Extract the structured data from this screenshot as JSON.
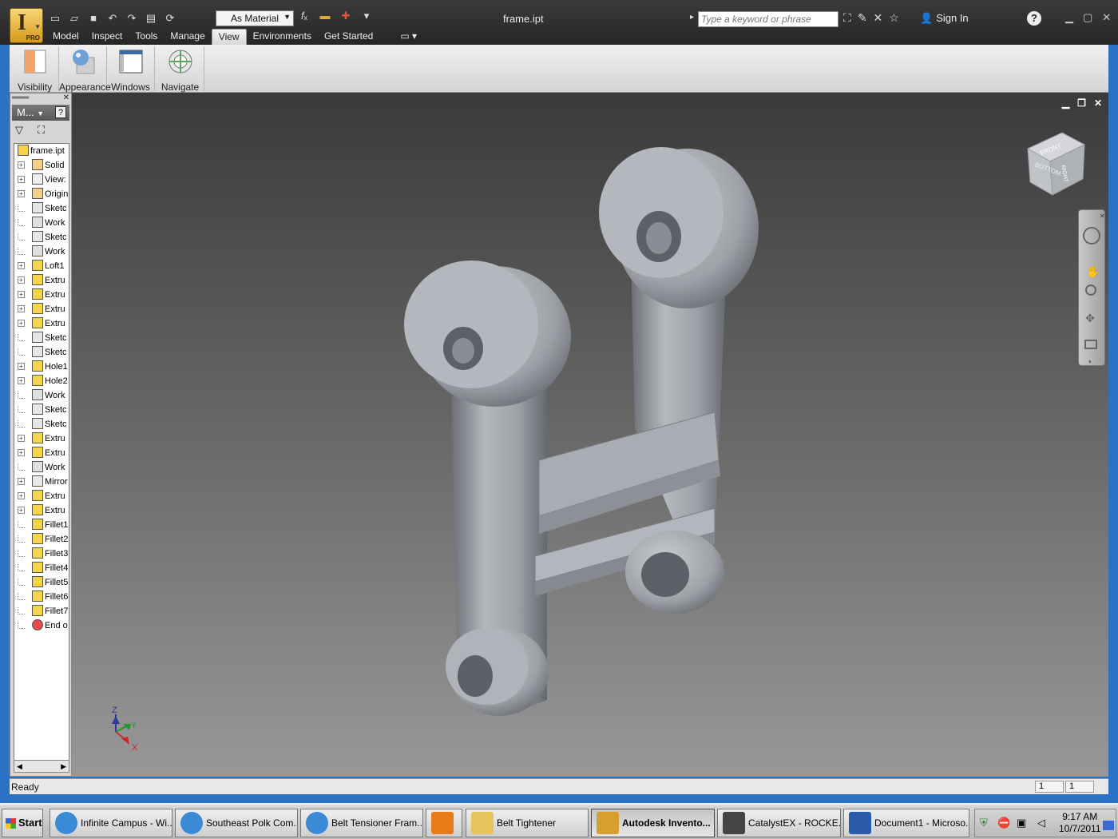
{
  "window": {
    "title": "frame.ipt"
  },
  "app": {
    "badge": "PRO"
  },
  "toolbar": {
    "material": "As Material"
  },
  "search": {
    "placeholder": "Type a keyword or phrase"
  },
  "account": {
    "sign_in": "Sign In",
    "help": "?"
  },
  "menu": [
    "Model",
    "Inspect",
    "Tools",
    "Manage",
    "View",
    "Environments",
    "Get Started"
  ],
  "ribbon": [
    "Visibility",
    "Appearance",
    "Windows",
    "Navigate"
  ],
  "browser": {
    "header": "M...",
    "help": "?",
    "root": "frame.ipt",
    "nodes": [
      {
        "label": "Solid",
        "icon": "folder-solid-icon",
        "expand": true
      },
      {
        "label": "View:",
        "icon": "view-rep-icon",
        "expand": true
      },
      {
        "label": "Origin",
        "icon": "folder-icon",
        "expand": true
      },
      {
        "label": "Sketc",
        "icon": "sketch-icon",
        "expand": false
      },
      {
        "label": "Work",
        "icon": "work-plane-icon",
        "expand": false
      },
      {
        "label": "Sketc",
        "icon": "sketch-icon",
        "expand": false
      },
      {
        "label": "Work",
        "icon": "work-plane-icon",
        "expand": false
      },
      {
        "label": "Loft1",
        "icon": "loft-icon",
        "expand": true
      },
      {
        "label": "Extru",
        "icon": "extrude-icon",
        "expand": true
      },
      {
        "label": "Extru",
        "icon": "extrude-icon",
        "expand": true
      },
      {
        "label": "Extru",
        "icon": "extrude-icon",
        "expand": true
      },
      {
        "label": "Extru",
        "icon": "extrude-icon",
        "expand": true
      },
      {
        "label": "Sketc",
        "icon": "sketch-icon",
        "expand": false
      },
      {
        "label": "Sketc",
        "icon": "sketch-icon",
        "expand": false
      },
      {
        "label": "Hole1",
        "icon": "hole-icon",
        "expand": true
      },
      {
        "label": "Hole2",
        "icon": "hole-icon",
        "expand": true
      },
      {
        "label": "Work",
        "icon": "work-plane-icon",
        "expand": false
      },
      {
        "label": "Sketc",
        "icon": "sketch-icon",
        "expand": false
      },
      {
        "label": "Sketc",
        "icon": "sketch-icon",
        "expand": false
      },
      {
        "label": "Extru",
        "icon": "extrude-icon",
        "expand": true
      },
      {
        "label": "Extru",
        "icon": "extrude-icon",
        "expand": true
      },
      {
        "label": "Work",
        "icon": "work-plane-icon",
        "expand": false
      },
      {
        "label": "Mirror",
        "icon": "mirror-icon",
        "expand": true
      },
      {
        "label": "Extru",
        "icon": "extrude-icon",
        "expand": true
      },
      {
        "label": "Extru",
        "icon": "extrude-icon",
        "expand": true
      },
      {
        "label": "Fillet1",
        "icon": "fillet-icon",
        "expand": false
      },
      {
        "label": "Fillet2",
        "icon": "fillet-icon",
        "expand": false
      },
      {
        "label": "Fillet3",
        "icon": "fillet-icon",
        "expand": false
      },
      {
        "label": "Fillet4",
        "icon": "fillet-icon",
        "expand": false
      },
      {
        "label": "Fillet5",
        "icon": "fillet-icon",
        "expand": false
      },
      {
        "label": "Fillet6",
        "icon": "fillet-icon",
        "expand": false
      },
      {
        "label": "Fillet7",
        "icon": "fillet-icon",
        "expand": false
      },
      {
        "label": "End o",
        "icon": "end-of-part-icon",
        "expand": false
      }
    ]
  },
  "viewcube": {
    "front": "FRONT",
    "right": "RIGHT",
    "bottom": "BOTTOM"
  },
  "axes": {
    "z": "Z",
    "y": "Y",
    "x": "X"
  },
  "status": {
    "text": "Ready",
    "field1": "1",
    "field2": "1"
  },
  "taskbar": {
    "start": "Start",
    "items": [
      {
        "label": "Infinite Campus - Wi...",
        "icon": "ie-icon"
      },
      {
        "label": "Southeast Polk Com...",
        "icon": "ie-icon"
      },
      {
        "label": "Belt Tensioner Fram...",
        "icon": "ie-icon"
      },
      {
        "label": "",
        "icon": "media-player-icon"
      },
      {
        "label": "Belt Tightener",
        "icon": "folder-icon"
      },
      {
        "label": "Autodesk Invento...",
        "icon": "inventor-icon"
      },
      {
        "label": "CatalystEX - ROCKE...",
        "icon": "catalyst-icon"
      },
      {
        "label": "Document1 - Microso...",
        "icon": "word-icon"
      }
    ],
    "time": "9:17 AM",
    "date": "10/7/2011"
  },
  "colors": {
    "accent": "#1c60b8",
    "viewport_top": "#3a3a3a",
    "viewport_bottom": "#989898"
  }
}
